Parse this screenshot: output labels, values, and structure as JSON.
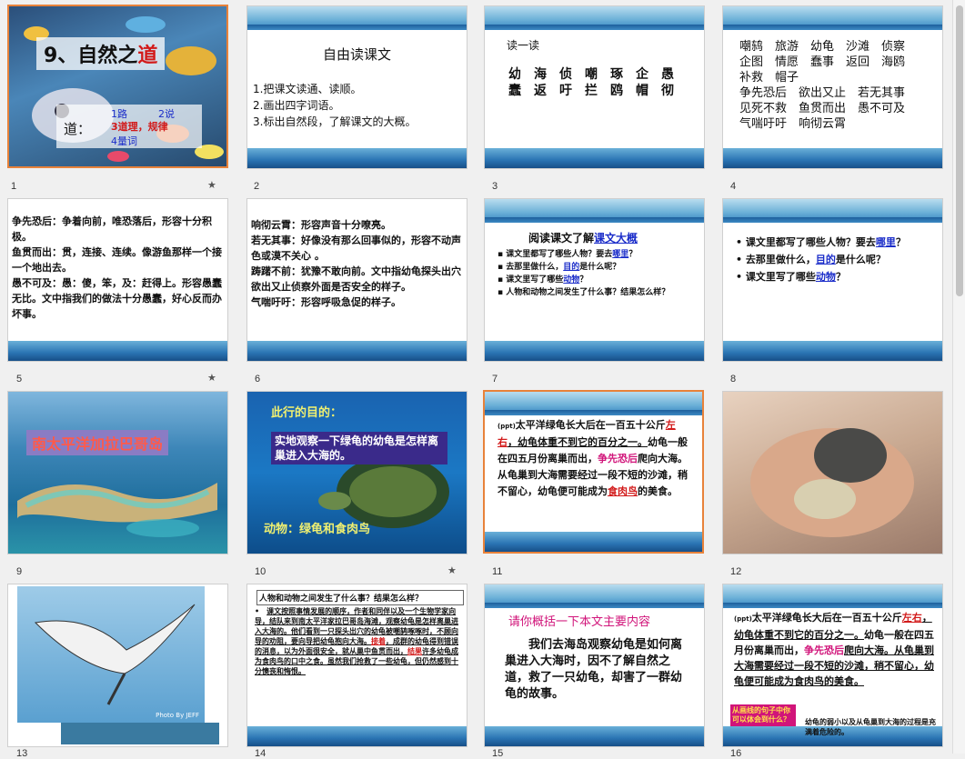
{
  "slides": [
    {
      "num": "1",
      "title_prefix": "9、自然之",
      "title_highlight": "道",
      "dao_label": "道：",
      "opt1": "1路",
      "opt2": "2说",
      "opt3": "3道理，规律",
      "opt4": "4量词"
    },
    {
      "num": "2",
      "title": "自由读课文",
      "l1": "1.把课文读通、读顺。",
      "l2": "2.画出四字词语。",
      "l3": "3.标出自然段，了解课文的大概。"
    },
    {
      "num": "3",
      "title": "读一读",
      "row1": "幼　海　侦　嘲　琢　企　愚",
      "row2": "蠢　返　吁　拦　鸥　帽　彻"
    },
    {
      "num": "4",
      "row1": "嘲鸫　旅游　幼龟　沙滩　侦察",
      "row2": "企图　情愿　蠢事　返回　海鸥",
      "row3": "补救　帽子",
      "row4": "争先恐后　欲出又止　若无其事",
      "row5": "见死不救　鱼贯而出　愚不可及",
      "row6": "气喘吁吁　响彻云霄"
    },
    {
      "num": "5",
      "b1": "争先恐后：争着向前，唯恐落后，形容十分积极。",
      "b2": "鱼贯而出：贯，连接、连续。像游鱼那样一个接一个地出去。",
      "b3": "愚不可及：愚：傻，笨，及：赶得上。形容愚蠢无比。文中指我们的做法十分愚蠢，好心反而办坏事。"
    },
    {
      "num": "6",
      "b1": "响彻云霄：形容声音十分嘹亮。",
      "b2": "若无其事：好像没有那么回事似的，形容不动声色或漠不关心 。",
      "b3": "踌躇不前：犹豫不敢向前。文中指幼龟探头出穴欲出又止侦察外面是否安全的样子。",
      "b4": "气喘吁吁：形容呼吸急促的样子。"
    },
    {
      "num": "7",
      "title_a": "阅读课文了解",
      "title_b": "课文大概",
      "q1a": "课文里都写了哪些人物？要去",
      "q1b": "哪里",
      "q1c": "？",
      "q2a": "去那里做什么，",
      "q2b": "目的",
      "q2c": "是什么呢？",
      "q3a": "课文里写了哪些",
      "q3b": "动物",
      "q3c": "？",
      "q4": "人物和动物之间发生了什么事？结果怎么样？"
    },
    {
      "num": "8",
      "q1a": "课文里都写了哪些人物？要去",
      "q1b": "哪里",
      "q1c": "？",
      "q2a": "去那里做什么，",
      "q2b": "目的",
      "q2c": "是什么呢？",
      "q3a": "课文里写了哪些",
      "q3b": "动物",
      "q3c": "？"
    },
    {
      "num": "9",
      "caption": "南太平洋加拉巴哥岛"
    },
    {
      "num": "10",
      "purpose": "此行的目的：",
      "purpose_text": "实地观察一下绿龟的幼龟是怎样离巢进入大海的。",
      "animals": "动物：绿龟和食肉鸟"
    },
    {
      "num": "11",
      "p_tag": "(ppt)",
      "p1": "太平洋绿龟长大后在一百五十公斤",
      "p1b": "左右",
      "p1c": "，幼龟体重不到它的百分之一。",
      "p2a": "幼龟一般在四五月份离巢而出，",
      "p2b": "争先恐后",
      "p2c": "爬向大海。从龟巢到大海需要经过一段不短的沙滩，稍不留心，幼龟便可能成为",
      "p2d": "食肉鸟",
      "p2e": "的美食。"
    },
    {
      "num": "12"
    },
    {
      "num": "13",
      "credit": "Photo By JEFF"
    },
    {
      "num": "14",
      "head": "人物和动物之间发生了什么事？结果怎么样？",
      "body_a": "课文按照事情发展的顺序，作者和同伴以及一个生物学家向导，结队来到南太平洋家拉巴哥岛海滩，观察幼龟是怎样离巢进入大海的。他们看到一只探头出穴的幼龟被嘲鸫啄啄时，不顾向导的劝阻，要向导把幼龟抱向大海。",
      "body_b": "接着",
      "body_c": "，成群的幼龟得到错误的消息，以为外面很安全，就从巢中鱼贯而出，",
      "body_d": "结果",
      "body_e": "许多幼龟成为食肉鸟的口中之食。虽然我们抢救了一些幼龟，但仍然感到十分懊丧和悔恨。"
    },
    {
      "num": "15",
      "prompt": "请你概括一下本文主要内容",
      "summary": "我们去海岛观察幼龟是如何离巢进入大海时，因不了解自然之道，救了一只幼龟，却害了一群幼龟的故事。"
    },
    {
      "num": "16",
      "p_tag": "(ppt)",
      "p1": "太平洋绿龟长大后在一百五十公斤",
      "p1b": "左右",
      "p1c": "，幼龟体重不到它的百分之一。",
      "p2a": "幼龟一般在四五月份离巢而出，",
      "p2b": "争先恐后",
      "p2c": "爬向大海。从龟巢到大海需要经过一段不短的沙滩，稍不留心，幼龟便可能成为食肉鸟的美食。",
      "note": "从画线的句子中你可以体会到什么？",
      "note2": "幼龟的弱小以及从龟巢到大海的过程是充满着危险的。"
    }
  ]
}
